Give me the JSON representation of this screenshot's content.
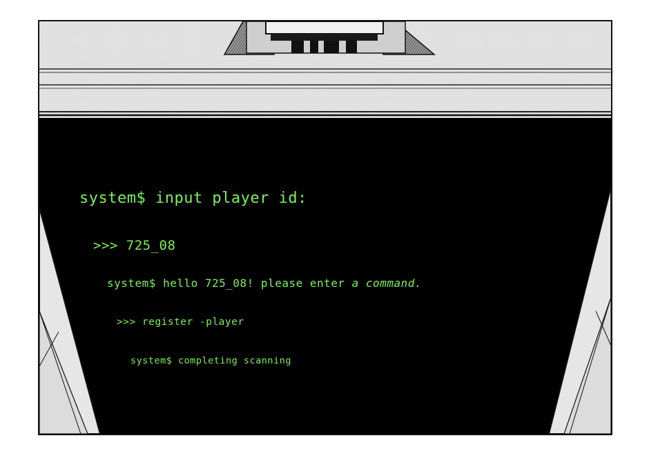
{
  "terminal": {
    "lines": [
      {
        "text": "system$ input player id:"
      },
      {
        "text": ">>> 725_08"
      },
      {
        "prefix": "system$ hello 725_08! please enter ",
        "italic": "a command."
      },
      {
        "text": ">>> register -player"
      },
      {
        "text": "system$ completing scanning"
      }
    ],
    "text_color": "#7cf25a"
  },
  "colors": {
    "screen": "#000000",
    "ceiling": "#e6e6e6",
    "ink": "#111111"
  }
}
